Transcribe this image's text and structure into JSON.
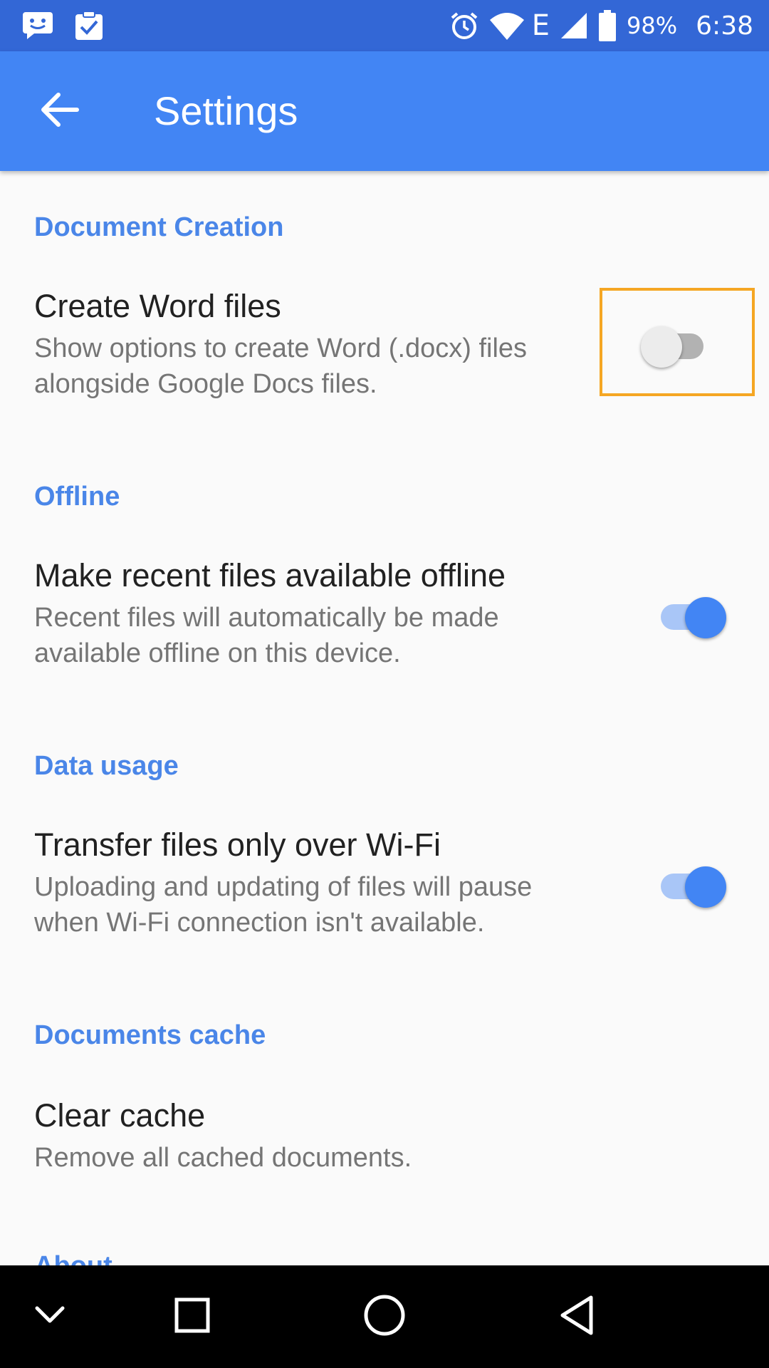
{
  "status_bar": {
    "time": "6:38",
    "battery_percent": "98%",
    "network_type": "E",
    "left_icons": [
      "messaging-icon",
      "clipboard-check-icon"
    ],
    "right_icons": [
      "alarm-icon",
      "wifi-icon",
      "signal-icon",
      "battery-icon"
    ]
  },
  "app_bar": {
    "title": "Settings",
    "back_icon": "arrow-back-icon",
    "background": "#4285f4"
  },
  "sections": [
    {
      "header": "Document Creation",
      "items": [
        {
          "title": "Create Word files",
          "summary": "Show options to create Word (.docx) files alongside Google Docs files.",
          "switch_on": false
        }
      ]
    },
    {
      "header": "Offline",
      "items": [
        {
          "title": "Make recent files available offline",
          "summary": "Recent files will automatically be made available offline on this device.",
          "switch_on": true
        }
      ]
    },
    {
      "header": "Data usage",
      "items": [
        {
          "title": "Transfer files only over Wi-Fi",
          "summary": "Uploading and updating of files will pause when Wi-Fi connection isn't available.",
          "switch_on": true
        }
      ]
    },
    {
      "header": "Documents cache",
      "items": [
        {
          "title": "Clear cache",
          "summary": "Remove all cached documents."
        }
      ]
    }
  ],
  "partial_section_header": "About",
  "nav_bar": {
    "icons": [
      "chevron-down-icon",
      "recents-icon",
      "home-icon",
      "back-triangle-icon"
    ]
  },
  "colors": {
    "status_bar": "#3367d6",
    "accent": "#4285f4",
    "section_header": "#4a86e8",
    "highlight": "#f5a623"
  }
}
